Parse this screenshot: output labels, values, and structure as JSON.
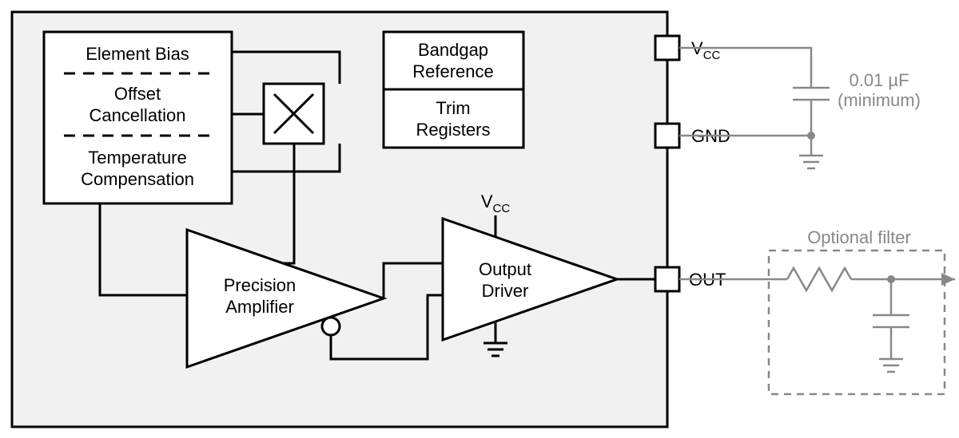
{
  "blocks": {
    "config": {
      "line1": "Element Bias",
      "line2a": "Offset",
      "line2b": "Cancellation",
      "line3a": "Temperature",
      "line3b": "Compensation"
    },
    "ref": {
      "line1": "Bandgap",
      "line2": "Reference",
      "line3": "Trim",
      "line4": "Registers"
    },
    "amp1": {
      "line1": "Precision",
      "line2": "Amplifier"
    },
    "amp2": {
      "line1": "Output",
      "line2": "Driver"
    },
    "amp2_supply": "V"
  },
  "pins": {
    "vcc": "V",
    "vcc_sub": "CC",
    "gnd": "GND",
    "out": "OUT"
  },
  "ext": {
    "cap_value": "0.01 µF",
    "cap_note": "(minimum)",
    "filter_label": "Optional filter"
  }
}
